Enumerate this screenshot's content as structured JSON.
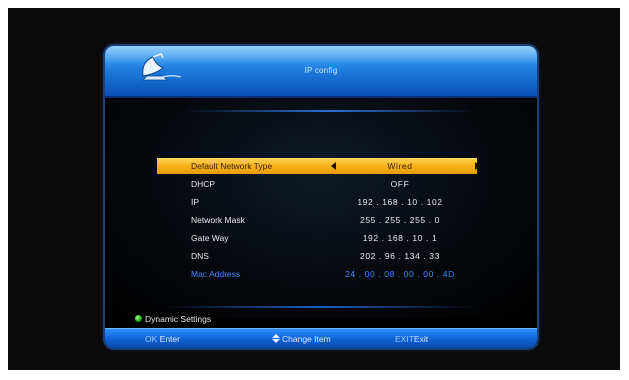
{
  "header": {
    "title": "IP config",
    "logo_icon": "satellite-dish-icon"
  },
  "settings": [
    {
      "label": "Default Network Type",
      "value": "Wired",
      "selected": true
    },
    {
      "label": "DHCP",
      "value": "OFF"
    },
    {
      "label": "IP",
      "value": "192 . 168 . 10 . 102"
    },
    {
      "label": "Network Mask",
      "value": "255 . 255 . 255 . 0"
    },
    {
      "label": "Gate Way",
      "value": "192 . 168 . 10 . 1"
    },
    {
      "label": "DNS",
      "value": "202 . 96 . 134 . 33"
    },
    {
      "label": "Mac Address",
      "value": "24 . 00 . 08 . 00 . 00 . 4D"
    }
  ],
  "dynamic_settings": {
    "label": "Dynamic Settings",
    "indicator_color": "#18a818"
  },
  "footer": {
    "ok_key": "OK",
    "ok_action": "Enter",
    "change_icon": "up-down-arrows-icon",
    "change_action": "Change Item",
    "exit_key": "EXIT",
    "exit_action": "Exit"
  },
  "colors": {
    "highlight": "#f7b21b",
    "accent_blue": "#1f7fe0",
    "mac_text": "#3d8cff"
  }
}
